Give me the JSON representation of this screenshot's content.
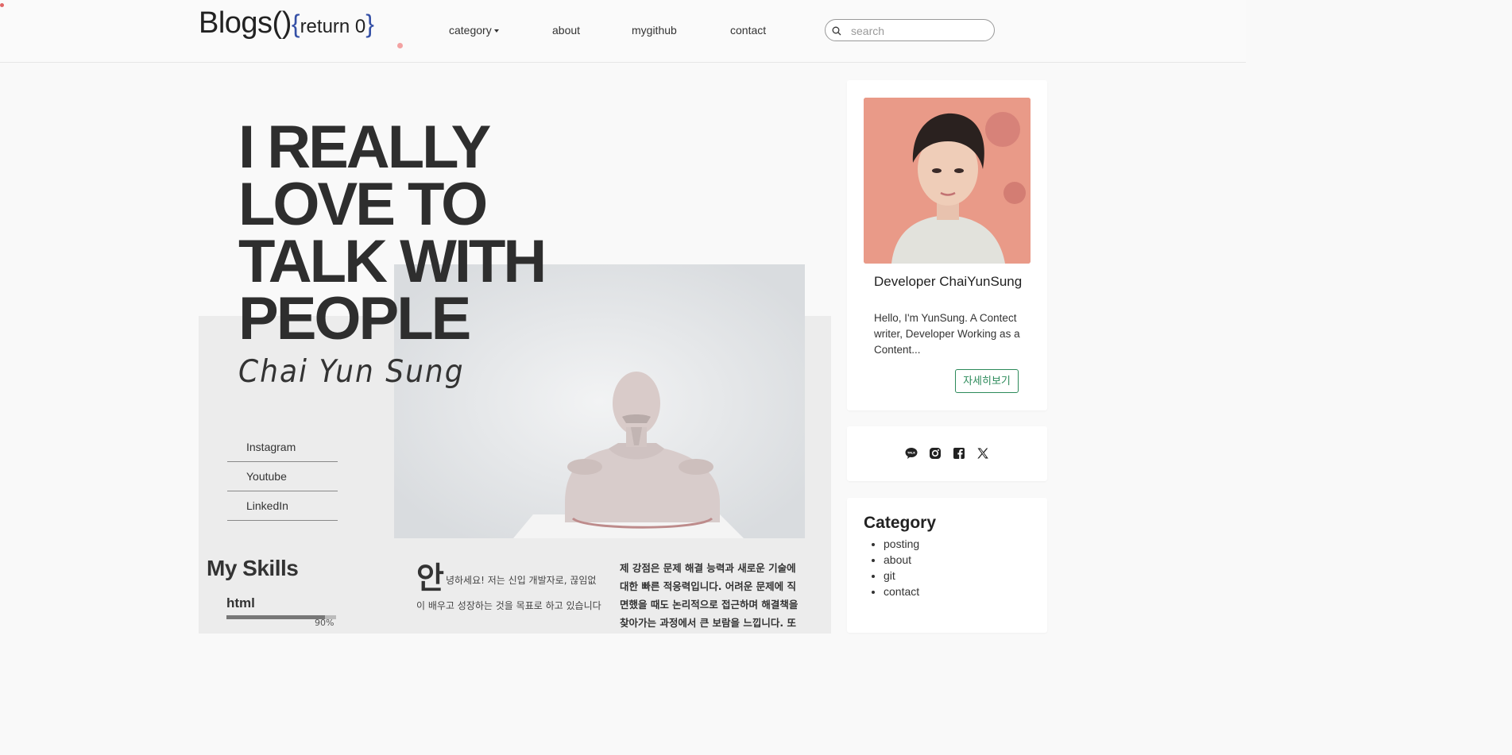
{
  "header": {
    "logo_main": "Blogs()",
    "logo_open_brace": "{",
    "logo_return": "return 0",
    "logo_close_brace": "}",
    "nav": {
      "category": "category",
      "about": "about",
      "mygithub": "mygithub",
      "contact": "contact"
    },
    "search_placeholder": "search"
  },
  "hero": {
    "headline_lines": [
      "I REALLY",
      "LOVE TO",
      "TALK WITH",
      "PEOPLE"
    ],
    "signature": "Chai Yun Sung"
  },
  "social_links": [
    "Instagram",
    "Youtube",
    "LinkedIn"
  ],
  "skills": {
    "title": "My Skills",
    "items": [
      {
        "name": "html",
        "percent_label": "90%",
        "level": 0.9
      }
    ]
  },
  "intro": {
    "first_char": "안",
    "text": "녕하세요! 저는 신입 개발자로, 끊임없이 배우고 성장하는 것을 목표로 하고 있습니다"
  },
  "strength": "제 강점은 문제 해결 능력과 새로운 기술에 대한 빠른 적응력입니다. 어려운 문제에 직면했을 때도 논리적으로 접근하며 해결책을 찾아가는 과정에서 큰 보람을 느낍니다. 또",
  "profile": {
    "name": "Developer ChaiYunSung",
    "description": "Hello, I'm YunSung. A Contect writer, Developer Working as a Content...",
    "more_button": "자세히보기"
  },
  "social_icons": [
    "kakaotalk-icon",
    "instagram-icon",
    "facebook-icon",
    "x-icon"
  ],
  "category": {
    "title": "Category",
    "items": [
      "posting",
      "about",
      "git",
      "contact"
    ]
  },
  "colors": {
    "logo_brace": "#3550a6",
    "button_green": "#2c8a5a",
    "accent_dot": "#f3a2a2"
  }
}
